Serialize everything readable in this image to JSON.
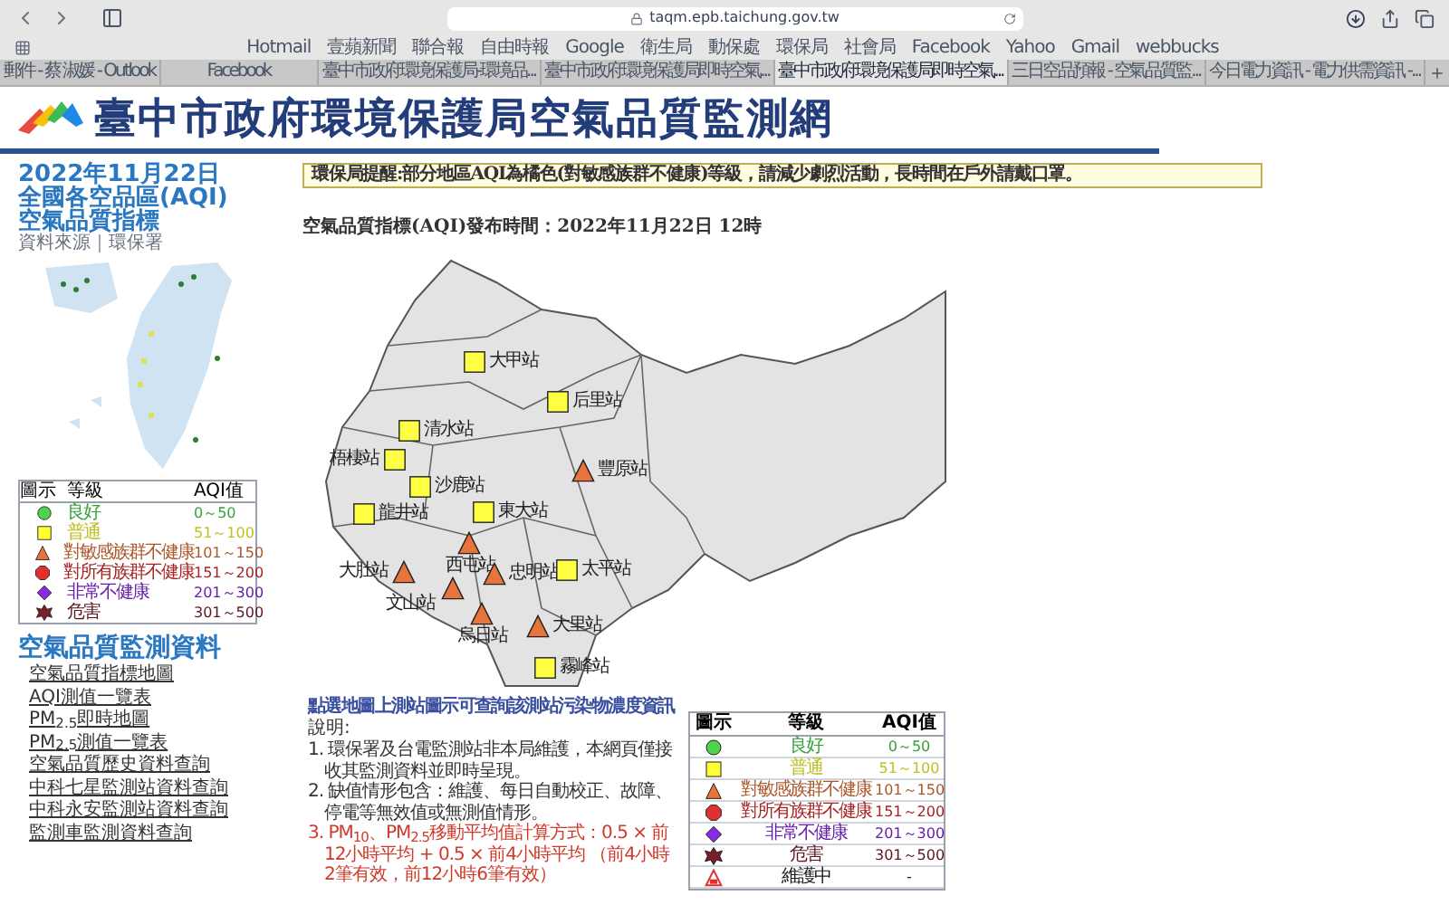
{
  "browser": {
    "url": "taqm.epb.taichung.gov.tw",
    "bookmarks": [
      "Hotmail",
      "壹蘋新聞",
      "聯合報",
      "自由時報",
      "Google",
      "衛生局",
      "動保處",
      "環保局",
      "社會局",
      "Facebook",
      "Yahoo",
      "Gmail",
      "webbucks"
    ],
    "tabs": [
      {
        "title": "郵件 - 蔡 淑媛 - Outlook",
        "selected": false
      },
      {
        "title": "Facebook",
        "selected": false
      },
      {
        "title": "臺中市政府環境保護局-環境品...",
        "selected": false
      },
      {
        "title": "臺中市政府環境保護局即時空氣...",
        "selected": false
      },
      {
        "title": "臺中市政府環境保護局即時空氣...",
        "selected": true
      },
      {
        "title": "三日空品預報 - 空氣品質監...",
        "selected": false
      },
      {
        "title": "今日電力資訊 - 電力供需資訊 -...",
        "selected": false
      }
    ]
  },
  "site": {
    "title": "臺中市政府環境保護局空氣品質監測網"
  },
  "sidebar": {
    "date_title": [
      "2022年11月22日",
      "全國各空品區(AQI)",
      "空氣品質指標"
    ],
    "source": "資料來源｜環保署",
    "legend": {
      "columns": [
        "圖示",
        "等級",
        "AQI值"
      ],
      "rows": [
        {
          "kind": "circle",
          "color": "#4cd44c",
          "grade": "良好",
          "range": "0～50"
        },
        {
          "kind": "square",
          "color": "#ffff33",
          "grade": "普通",
          "range": "51～100"
        },
        {
          "kind": "triangle",
          "color": "#e8743b",
          "grade": "對敏感族群不健康",
          "range": "101～150"
        },
        {
          "kind": "hexagon",
          "color": "#e03030",
          "grade": "對所有族群不健康",
          "range": "151～200"
        },
        {
          "kind": "diamond",
          "color": "#8a2be2",
          "grade": "非常不健康",
          "range": "201～300"
        },
        {
          "kind": "star",
          "color": "#7a1f2a",
          "grade": "危害",
          "range": "301～500"
        }
      ]
    },
    "section_title": "空氣品質監測資料",
    "links": [
      "空氣品質指標地圖",
      "AQI測值一覽表",
      "PM$_{2.5}$即時地圖",
      "PM$_{2.5}$測值一覽表",
      "空氣品質歷史資料查詢",
      "中科七星監測站資料查詢",
      "中科永安監測站資料查詢",
      "監測車監測資料查詢"
    ]
  },
  "notice": "環保局提醒:部分地區AQI為橘色(對敏感族群不健康)等級，請減少劇烈活動，長時間在戶外請戴口罩。",
  "publish_time": "空氣品質指標(AQI)發布時間：2022年11月22日 12時",
  "map": {
    "stations": [
      {
        "name": "大甲站",
        "kind": "square"
      },
      {
        "name": "后里站",
        "kind": "square"
      },
      {
        "name": "清水站",
        "kind": "square"
      },
      {
        "name": "梧棲站",
        "kind": "square"
      },
      {
        "name": "沙鹿站",
        "kind": "square"
      },
      {
        "name": "龍井站",
        "kind": "square"
      },
      {
        "name": "東大站",
        "kind": "square"
      },
      {
        "name": "豐原站",
        "kind": "triangle"
      },
      {
        "name": "大肚站",
        "kind": "triangle"
      },
      {
        "name": "西屯站",
        "kind": "triangle"
      },
      {
        "name": "忠明站",
        "kind": "triangle"
      },
      {
        "name": "文山站",
        "kind": "triangle"
      },
      {
        "name": "太平站",
        "kind": "square"
      },
      {
        "name": "烏日站",
        "kind": "triangle"
      },
      {
        "name": "大里站",
        "kind": "triangle"
      },
      {
        "name": "霧峰站",
        "kind": "square"
      }
    ]
  },
  "instructions": {
    "lead": "點選地圖上測站圖示可查詢該測站污染物濃度資訊",
    "heading": "說明:",
    "items": [
      {
        "kind": "normal",
        "text": "1. 環保署及台電監測站非本局維護，本網頁僅接收其監測資料並即時呈現。"
      },
      {
        "kind": "normal",
        "text": "2. 缺值情形包含：維護、每日自動校正、故障、停電等無效值或無測值情形。"
      },
      {
        "kind": "warning",
        "text": "3. PM$_{10}$、PM$_{2.5}$移動平均值計算方式：0.5 × 前12小時平均 + 0.5 × 前4小時平均 （前4小時2筆有效，前12小時6筆有效）"
      }
    ]
  },
  "legend": {
    "columns": [
      "圖示",
      "等級",
      "AQI值"
    ],
    "rows": [
      {
        "kind": "circle",
        "color": "#4cd44c",
        "grade": "良好",
        "range": "0～50"
      },
      {
        "kind": "square",
        "color": "#ffff33",
        "grade": "普通",
        "range": "51～100"
      },
      {
        "kind": "triangle",
        "color": "#e8743b",
        "grade": "對敏感族群不健康",
        "range": "101～150"
      },
      {
        "kind": "hexagon",
        "color": "#e03030",
        "grade": "對所有族群不健康",
        "range": "151～200"
      },
      {
        "kind": "diamond",
        "color": "#8a2be2",
        "grade": "非常不健康",
        "range": "201～300"
      },
      {
        "kind": "star",
        "color": "#7a1f2a",
        "grade": "危害",
        "range": "301～500"
      },
      {
        "kind": "maintenance",
        "color": "#e03030",
        "grade": "維護中",
        "range": "-"
      }
    ]
  }
}
